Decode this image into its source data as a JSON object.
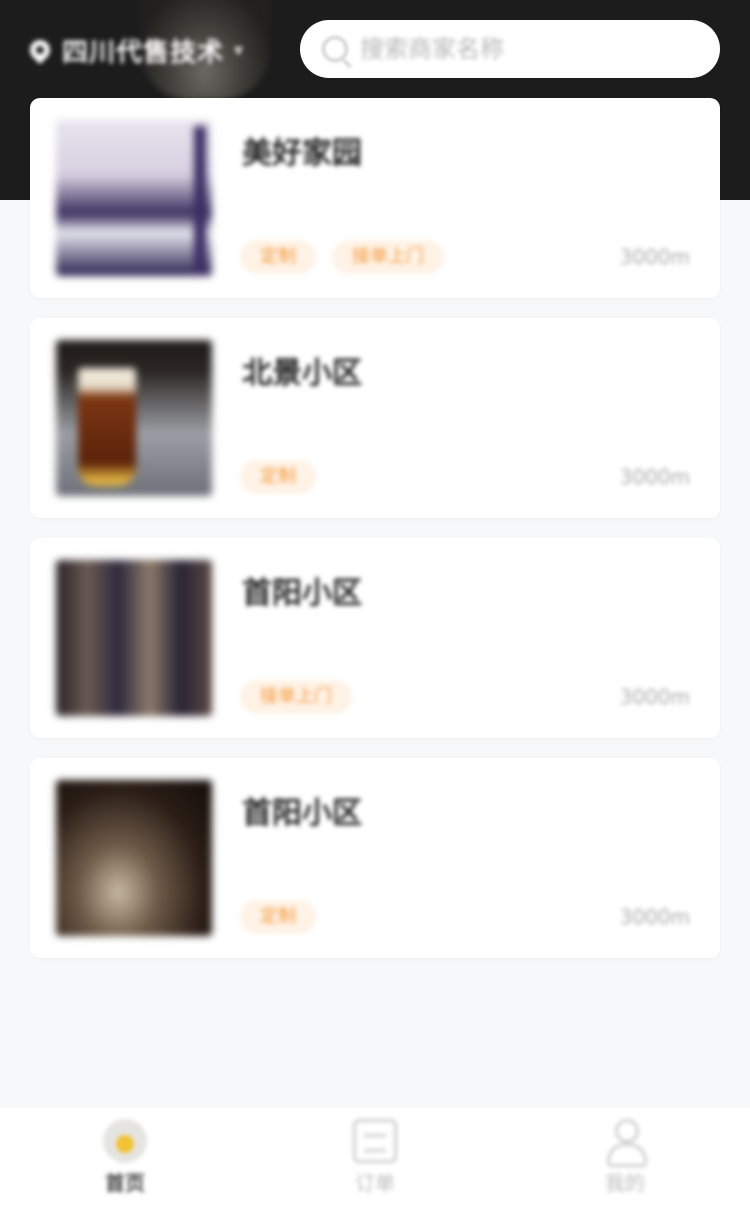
{
  "header": {
    "location": "四川代售技术",
    "search_placeholder": "搜索商家名称"
  },
  "shops": [
    {
      "name": "美好家园",
      "tags": [
        "定制",
        "接单上门"
      ],
      "distance": "3000m",
      "image": "shop-photo-1"
    },
    {
      "name": "北景小区",
      "tags": [
        "定制"
      ],
      "distance": "3000m",
      "image": "beer-glass-photo"
    },
    {
      "name": "首阳小区",
      "tags": [
        "接单上门"
      ],
      "distance": "3000m",
      "image": "bottles-photo"
    },
    {
      "name": "首阳小区",
      "tags": [
        "定制"
      ],
      "distance": "3000m",
      "image": "bar-photo"
    }
  ],
  "tabbar": [
    {
      "label": "首页",
      "icon": "home-icon",
      "active": true
    },
    {
      "label": "订单",
      "icon": "orders-icon",
      "active": false
    },
    {
      "label": "我的",
      "icon": "user-icon",
      "active": false
    }
  ],
  "colors": {
    "header_bg": "#1c1c1c",
    "page_bg": "#f7f8fa",
    "tag_text": "#f39a3b",
    "tag_bg": "#fff2e6"
  }
}
